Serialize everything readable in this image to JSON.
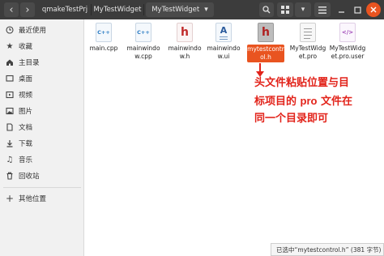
{
  "header": {
    "breadcrumbs": [
      "qmakeTestPrj",
      "MyTestWidget",
      "MyTestWidget"
    ],
    "back_glyph": "‹",
    "forward_glyph": "›",
    "dropdown_glyph": "▾"
  },
  "sidebar": {
    "items": [
      {
        "label": "最近使用",
        "icon": "clock-icon"
      },
      {
        "label": "收藏",
        "icon": "star-icon"
      },
      {
        "label": "主目录",
        "icon": "home-icon"
      },
      {
        "label": "桌面",
        "icon": "desktop-icon"
      },
      {
        "label": "视频",
        "icon": "video-icon"
      },
      {
        "label": "图片",
        "icon": "picture-icon"
      },
      {
        "label": "文档",
        "icon": "document-icon"
      },
      {
        "label": "下载",
        "icon": "download-icon"
      },
      {
        "label": "音乐",
        "icon": "music-icon"
      },
      {
        "label": "回收站",
        "icon": "trash-icon"
      },
      {
        "label": "其他位置",
        "icon": "plus-icon"
      }
    ]
  },
  "files": [
    {
      "name": "main.cpp",
      "type": "cpp",
      "badge": "C++"
    },
    {
      "name": "mainwindow.cpp",
      "type": "cpp",
      "badge": "C++"
    },
    {
      "name": "mainwindow.h",
      "type": "h",
      "badge": "h"
    },
    {
      "name": "mainwindow.ui",
      "type": "ui",
      "badge": "A"
    },
    {
      "name": "mytestcontrol.h",
      "type": "h",
      "badge": "h",
      "selected": true
    },
    {
      "name": "MyTestWidget.pro",
      "type": "pro",
      "badge": ""
    },
    {
      "name": "MyTestWidget.pro.user",
      "type": "user",
      "badge": "</>"
    }
  ],
  "annotation": {
    "line1": "头文件粘贴位置与目",
    "line2a": "标项目的 ",
    "line2b": "pro",
    "line2c": " 文件在",
    "line3": "同一个目录即可"
  },
  "status": "已选中“mytestcontrol.h” (381 字节)",
  "colors": {
    "header_bg": "#3c3c3c",
    "selection": "#e95420",
    "annotation": "#e2231a",
    "cpp_blue": "#2a7bc4",
    "h_red": "#c02a2a"
  }
}
